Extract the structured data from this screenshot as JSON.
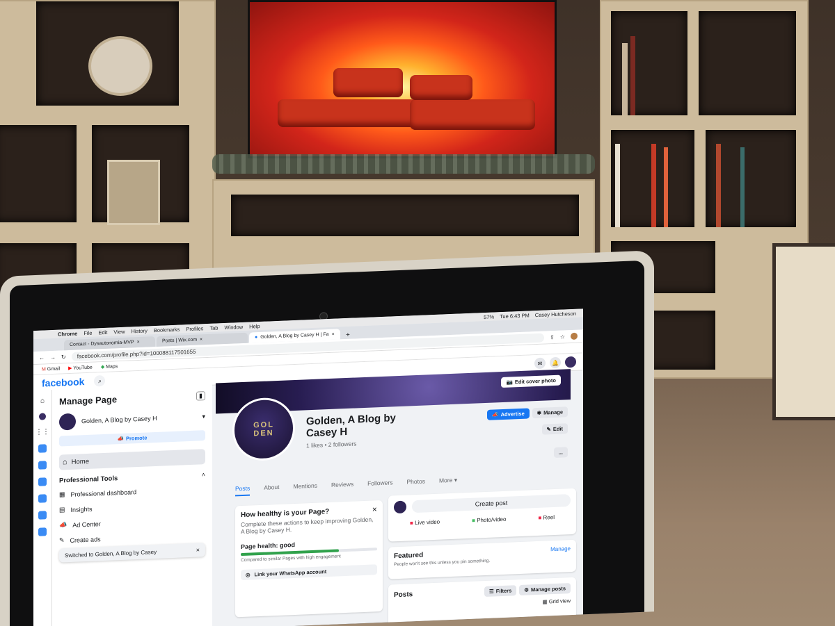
{
  "mac_menu": {
    "apple": "",
    "items": [
      "Chrome",
      "File",
      "Edit",
      "View",
      "History",
      "Bookmarks",
      "Profiles",
      "Tab",
      "Window",
      "Help"
    ],
    "battery": "57%",
    "clock": "Tue 6:43 PM",
    "user": "Casey Hutcheson"
  },
  "browser": {
    "tabs": [
      {
        "label": "Contact - Dysautonomia-MVP"
      },
      {
        "label": "Posts | Wix.com"
      },
      {
        "label": "Golden, A Blog by Casey H | Fa"
      }
    ],
    "new_tab": "+",
    "url": "facebook.com/profile.php?id=100088117501655",
    "bookmarks": [
      "Gmail",
      "YouTube",
      "Maps"
    ]
  },
  "facebook": {
    "logo": "facebook",
    "sidebar": {
      "title": "Manage Page",
      "page_name": "Golden, A Blog by Casey H",
      "promote": "Promote",
      "home": "Home",
      "section": "Professional Tools",
      "items": [
        "Professional dashboard",
        "Insights",
        "Ad Center",
        "Create ads"
      ],
      "toast": "Switched to Golden, A Blog by Casey"
    },
    "cover_button": "Edit cover photo",
    "avatar_text": "GOL DEN",
    "page_title_line1": "Golden, A Blog by",
    "page_title_line2": "Casey H",
    "stats": "1 likes • 2 followers",
    "actions": {
      "advertise": "Advertise",
      "manage": "Manage",
      "edit": "Edit",
      "more": "..."
    },
    "tabs": [
      "Posts",
      "About",
      "Mentions",
      "Reviews",
      "Followers",
      "Photos",
      "More"
    ],
    "health": {
      "title": "How healthy is your Page?",
      "desc": "Complete these actions to keep improving Golden, A Blog by Casey H.",
      "label": "Page health: good",
      "compare": "Compared to similar Pages with high engagement",
      "whatsapp": "Link your WhatsApp account",
      "level": 0.72
    },
    "composer": {
      "create": "Create post",
      "live": "Live video",
      "photo": "Photo/video",
      "reel": "Reel"
    },
    "featured": {
      "title": "Featured",
      "manage": "Manage",
      "desc": "People won't see this unless you pin something."
    },
    "posts": {
      "title": "Posts",
      "filters": "Filters",
      "manage": "Manage posts",
      "grid": "Grid view"
    }
  },
  "colors": {
    "facebook_blue": "#1877f2",
    "health_green": "#31a24c",
    "fire": "#ff5a1a"
  }
}
